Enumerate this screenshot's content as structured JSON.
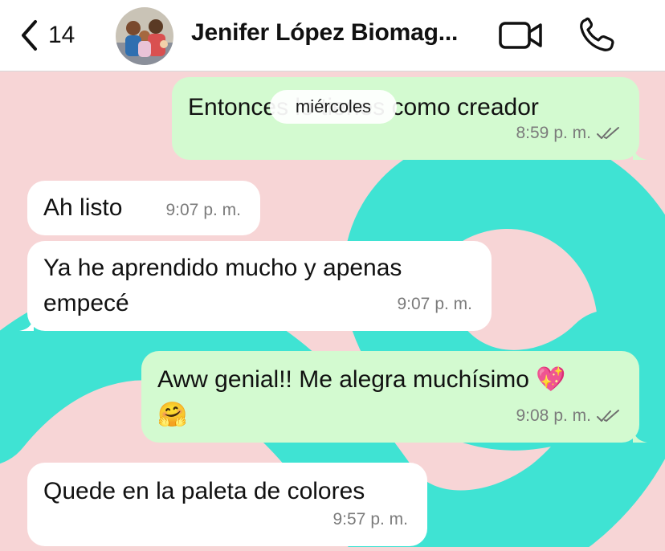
{
  "header": {
    "back_count": "14",
    "contact_name": "Jenifer López Biomag...",
    "icons": {
      "back": "chevron-left-icon",
      "video": "video-camera-icon",
      "call": "phone-icon"
    }
  },
  "date_separator": "miércoles",
  "messages": [
    {
      "direction": "out",
      "text": "Entonces lo tienes como creador",
      "time": "8:59",
      "ampm": "p. m.",
      "status": "read"
    },
    {
      "direction": "in",
      "text": "Ah listo",
      "time": "9:07",
      "ampm": "p. m."
    },
    {
      "direction": "in",
      "text_line1": "Ya he aprendido mucho y apenas",
      "text_line2": "empecé",
      "time": "9:07",
      "ampm": "p. m."
    },
    {
      "direction": "out",
      "text_line1": "Aww genial!! Me alegra muchísimo 💖",
      "text_line2": "🤗",
      "time": "9:08",
      "ampm": "p. m.",
      "status": "read"
    },
    {
      "direction": "in",
      "text": "Quede en la paleta de colores",
      "time": "9:57",
      "ampm": "p. m."
    }
  ],
  "colors": {
    "wallpaper": "#f7d5d6",
    "swirl": "#3fe3d3",
    "incoming_bubble": "#ffffff",
    "outgoing_bubble": "#d3fad0"
  }
}
